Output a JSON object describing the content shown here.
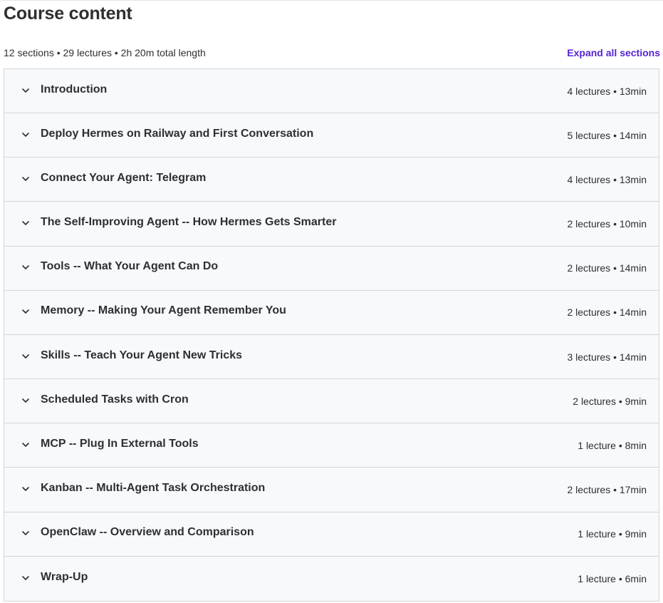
{
  "header": {
    "title": "Course content",
    "summary": "12 sections • 29 lectures • 2h 20m total length",
    "expand_label": "Expand all sections"
  },
  "sections": [
    {
      "title": "Introduction",
      "meta": "4 lectures • 13min"
    },
    {
      "title": "Deploy Hermes on Railway and First Conversation",
      "meta": "5 lectures • 14min"
    },
    {
      "title": "Connect Your Agent: Telegram",
      "meta": "4 lectures • 13min"
    },
    {
      "title": "The Self-Improving Agent -- How Hermes Gets Smarter",
      "meta": "2 lectures • 10min"
    },
    {
      "title": "Tools -- What Your Agent Can Do",
      "meta": "2 lectures • 14min"
    },
    {
      "title": "Memory -- Making Your Agent Remember You",
      "meta": "2 lectures • 14min"
    },
    {
      "title": "Skills -- Teach Your Agent New Tricks",
      "meta": "3 lectures • 14min"
    },
    {
      "title": "Scheduled Tasks with Cron",
      "meta": "2 lectures • 9min"
    },
    {
      "title": "MCP -- Plug In External Tools",
      "meta": "1 lecture • 8min"
    },
    {
      "title": "Kanban -- Multi-Agent Task Orchestration",
      "meta": "2 lectures • 17min"
    },
    {
      "title": "OpenClaw -- Overview and Comparison",
      "meta": "1 lecture • 9min"
    },
    {
      "title": "Wrap-Up",
      "meta": "1 lecture • 6min"
    }
  ],
  "icons": {
    "section_toggle": "chevron-down-icon"
  },
  "colors": {
    "accent": "#5624d0",
    "text": "#2d2f31",
    "section_bg": "#f7f9fa",
    "border": "#d1d7dc"
  }
}
